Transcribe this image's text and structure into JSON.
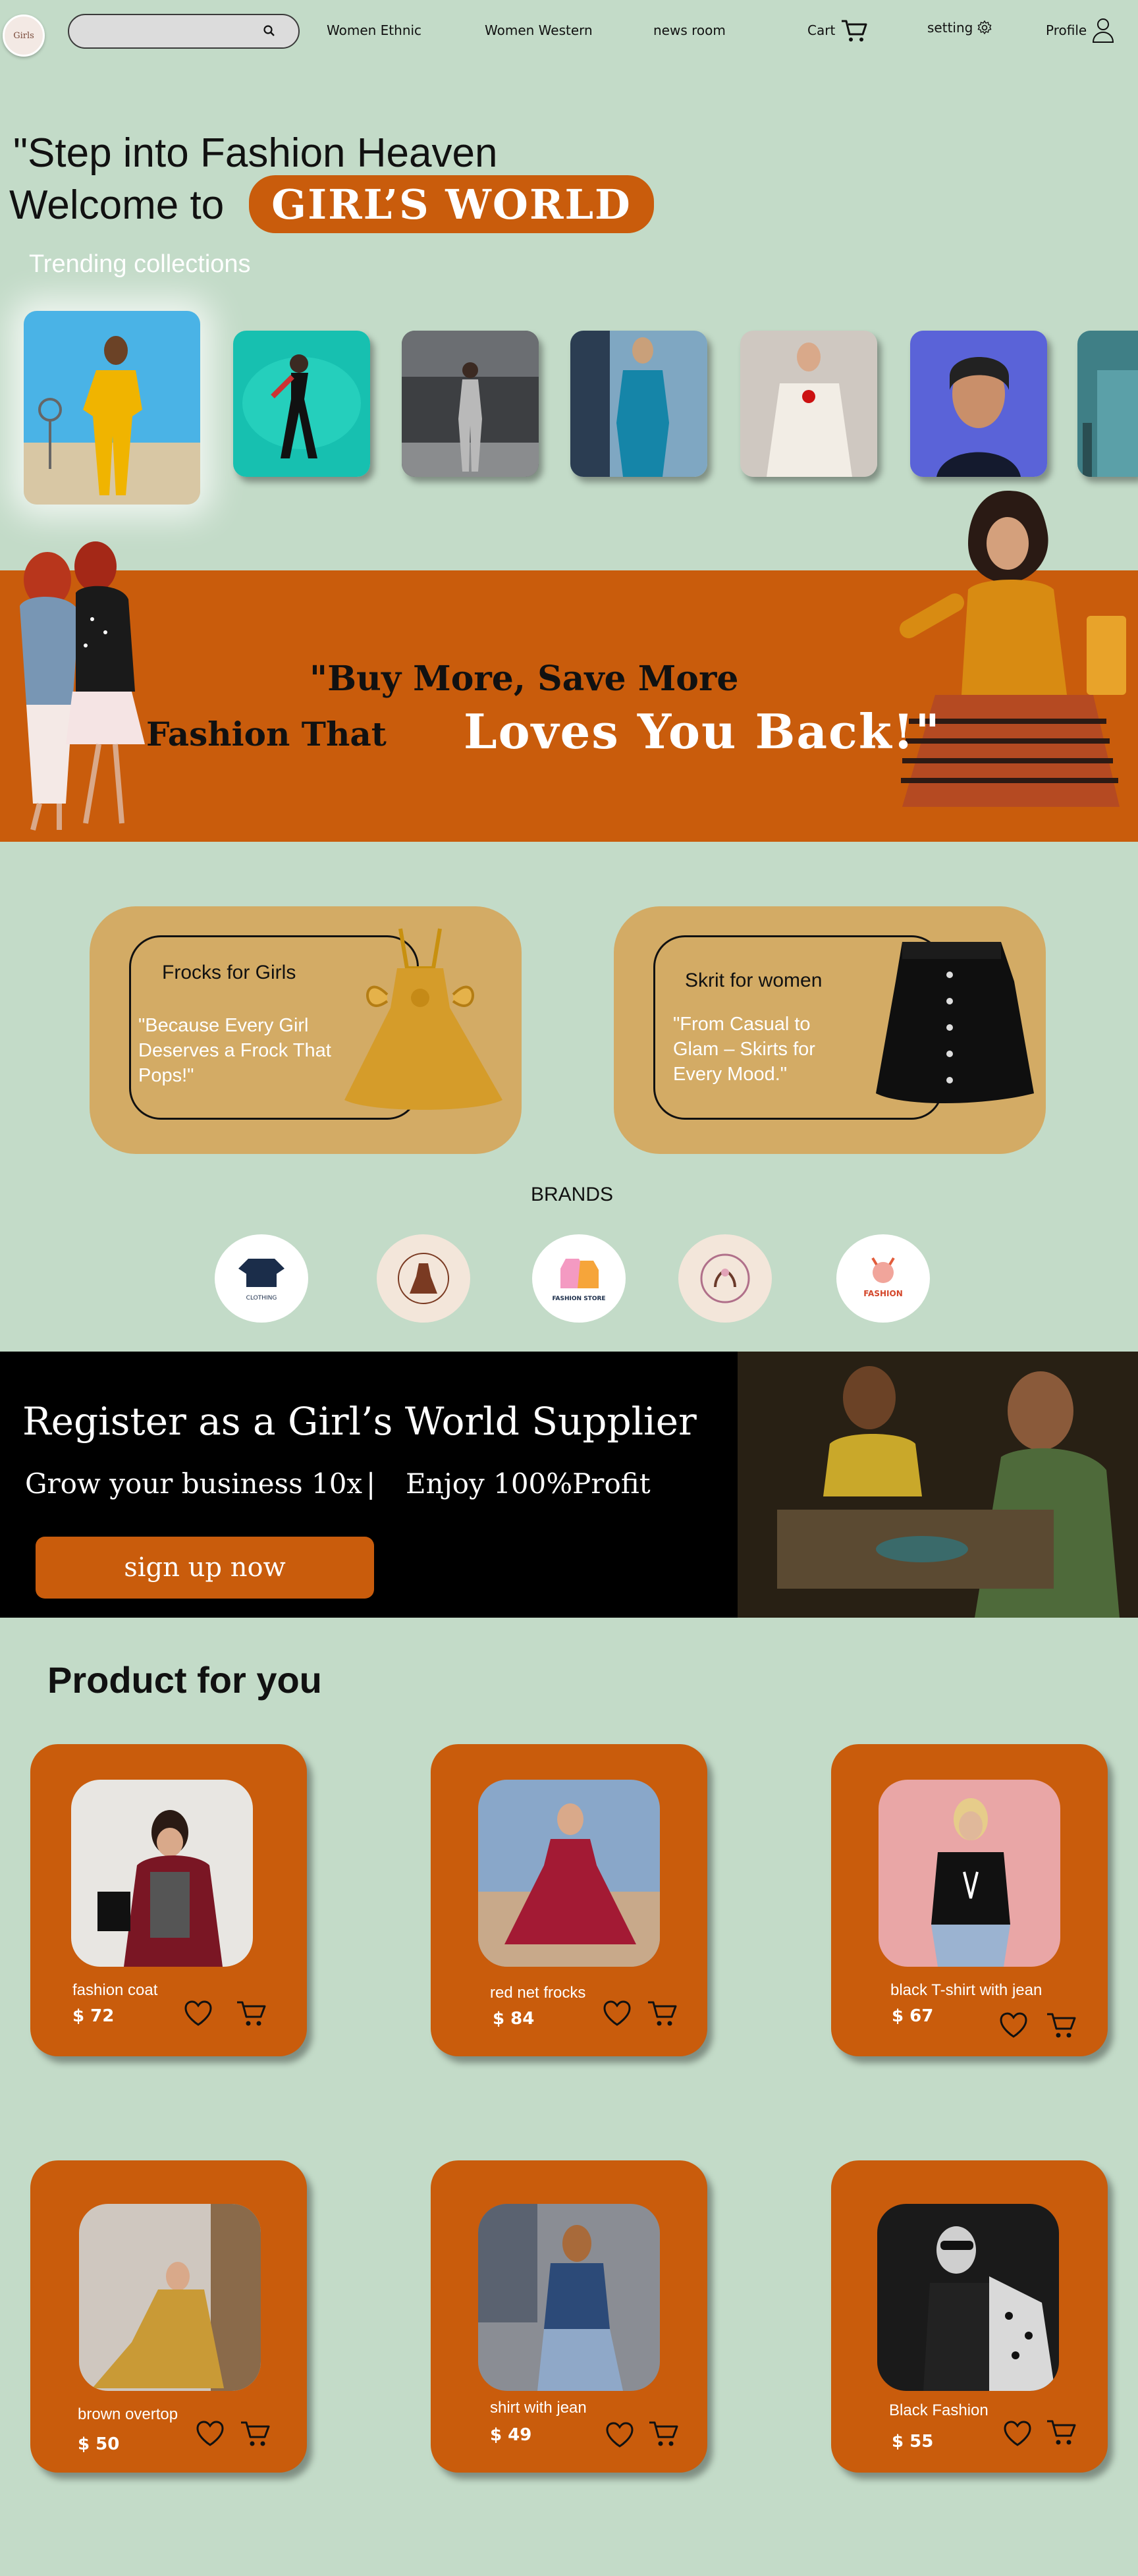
{
  "nav": {
    "logo_text": "Girls",
    "search_placeholder": "",
    "links": [
      "Women Ethnic",
      "Women Western",
      "news room"
    ],
    "cart_label": "Cart",
    "setting_label": "setting",
    "profile_label": "Profile"
  },
  "hero": {
    "line1": "\"Step into Fashion Heaven",
    "line2": "Welcome to",
    "brand_badge": "GIRL’S WORLD",
    "trending_title": "Trending collections"
  },
  "banner": {
    "line1": "\"Buy More, Save More",
    "line2": "Fashion That",
    "line2_highlight": "Loves You Back!\""
  },
  "categories": [
    {
      "title": "Frocks for Girls",
      "quote": "\"Because Every Girl Deserves a Frock That Pops!\""
    },
    {
      "title": "Skrit for women",
      "quote": "\"From Casual to Glam – Skirts for Every Mood.\""
    }
  ],
  "brands": {
    "title": "BRANDS",
    "items": [
      {
        "label": "CLOTHING"
      },
      {
        "label": ""
      },
      {
        "label": "FASHION STORE"
      },
      {
        "label": ""
      },
      {
        "label": "FASHION"
      }
    ]
  },
  "supplier": {
    "title": "Register as a Girl’s World Supplier",
    "sub1": "Grow your business 10x",
    "separator": "|",
    "sub2": "Enjoy 100%Profit",
    "cta": "sign up now"
  },
  "products": {
    "title": "Product for you",
    "items": [
      {
        "name": "fashion coat",
        "price": "$ 72"
      },
      {
        "name": "red net frocks",
        "price": "$ 84"
      },
      {
        "name": "black T-shirt with jean",
        "price": "$ 67"
      },
      {
        "name": "brown overtop",
        "price": "$ 50"
      },
      {
        "name": "shirt with jean",
        "price": "$ 49"
      },
      {
        "name": "Black Fashion",
        "price": "$ 55"
      }
    ]
  },
  "colors": {
    "background": "#c3dbc8",
    "accent": "#c95c0c",
    "card_tan": "#d3ab65"
  }
}
